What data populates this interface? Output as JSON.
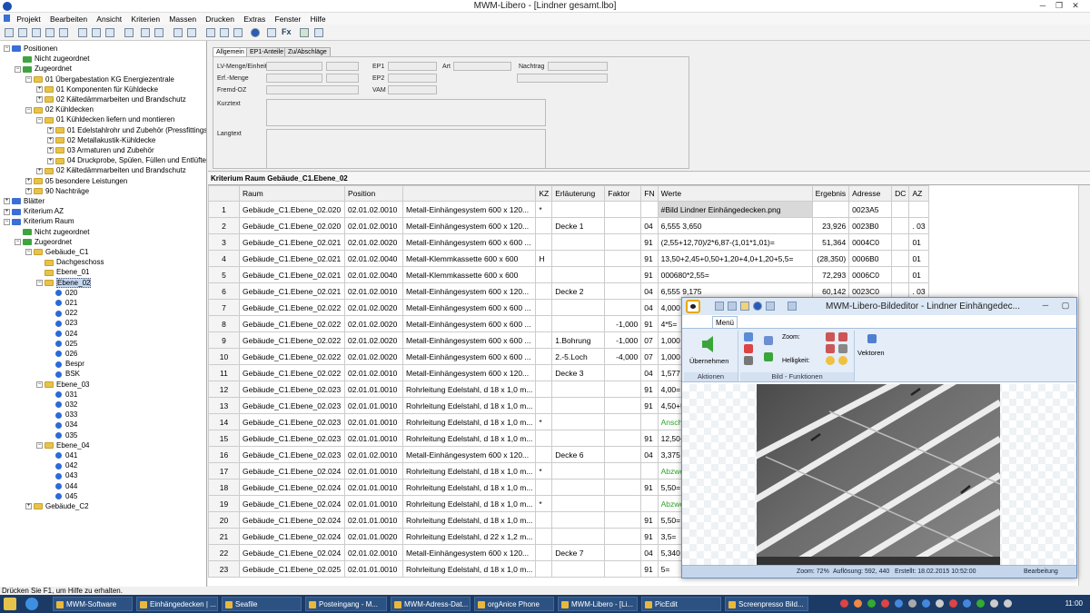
{
  "window": {
    "title": "MWM-Libero - [Lindner gesamt.lbo]"
  },
  "menu": [
    "Projekt",
    "Bearbeiten",
    "Ansicht",
    "Kriterien",
    "Massen",
    "Drucken",
    "Extras",
    "Fenster",
    "Hilfe"
  ],
  "toolbar": {
    "fx_label": "Fx"
  },
  "tree": [
    {
      "label": "Positionen",
      "level": 0,
      "icon": "blue",
      "exp": "−"
    },
    {
      "label": "Nicht zugeordnet",
      "level": 1,
      "icon": "green"
    },
    {
      "label": "Zugeordnet",
      "level": 1,
      "icon": "green",
      "exp": "−"
    },
    {
      "label": "01 Übergabestation KG Energiezentrale",
      "level": 2,
      "icon": "yellow",
      "exp": "−"
    },
    {
      "label": "01 Komponenten für Kühldecke",
      "level": 3,
      "icon": "yellow",
      "exp": "+"
    },
    {
      "label": "02 Kältedämmarbeiten und Brandschutz",
      "level": 3,
      "icon": "yellow",
      "exp": "+"
    },
    {
      "label": "02 Kühldecken",
      "level": 2,
      "icon": "yellow",
      "exp": "−"
    },
    {
      "label": "01 Kühldecken liefern und montieren",
      "level": 3,
      "icon": "yellow",
      "exp": "−"
    },
    {
      "label": "01 Edelstahlrohr und Zubehör (Pressfittings)",
      "level": 4,
      "icon": "yellow",
      "exp": "+"
    },
    {
      "label": "02 Metallakustik-Kühldecke",
      "level": 4,
      "icon": "yellow",
      "exp": "+"
    },
    {
      "label": "03 Armaturen und Zubehör",
      "level": 4,
      "icon": "yellow",
      "exp": "+"
    },
    {
      "label": "04 Druckprobe, Spülen, Füllen und Entlüften",
      "level": 4,
      "icon": "yellow",
      "exp": "+"
    },
    {
      "label": "02 Kältedämmarbeiten und Brandschutz",
      "level": 3,
      "icon": "yellow",
      "exp": "+"
    },
    {
      "label": "05 besondere Leistungen",
      "level": 2,
      "icon": "yellow",
      "exp": "+"
    },
    {
      "label": "90 Nachträge",
      "level": 2,
      "icon": "yellow",
      "exp": "+"
    },
    {
      "label": "Blätter",
      "level": 0,
      "icon": "blue",
      "exp": "+"
    },
    {
      "label": "Kriterium AZ",
      "level": 0,
      "icon": "blue",
      "exp": "+"
    },
    {
      "label": "Kriterium Raum",
      "level": 0,
      "icon": "blue",
      "exp": "−"
    },
    {
      "label": "Nicht zugeordnet",
      "level": 1,
      "icon": "green"
    },
    {
      "label": "Zugeordnet",
      "level": 1,
      "icon": "green",
      "exp": "−"
    },
    {
      "label": "Gebäude_C1",
      "level": 2,
      "icon": "yellow",
      "exp": "−"
    },
    {
      "label": "Dachgeschoss",
      "level": 3,
      "icon": "yellow"
    },
    {
      "label": "Ebene_01",
      "level": 3,
      "icon": "yellow"
    },
    {
      "label": "Ebene_02",
      "level": 3,
      "icon": "yellow",
      "exp": "−",
      "selected": true
    },
    {
      "label": "020",
      "level": 4,
      "icon": "dot"
    },
    {
      "label": "021",
      "level": 4,
      "icon": "dot"
    },
    {
      "label": "022",
      "level": 4,
      "icon": "dot"
    },
    {
      "label": "023",
      "level": 4,
      "icon": "dot"
    },
    {
      "label": "024",
      "level": 4,
      "icon": "dot"
    },
    {
      "label": "025",
      "level": 4,
      "icon": "dot"
    },
    {
      "label": "026",
      "level": 4,
      "icon": "dot"
    },
    {
      "label": "Bespr",
      "level": 4,
      "icon": "dot"
    },
    {
      "label": "BSK",
      "level": 4,
      "icon": "dot"
    },
    {
      "label": "Ebene_03",
      "level": 3,
      "icon": "yellow",
      "exp": "−"
    },
    {
      "label": "031",
      "level": 4,
      "icon": "dot"
    },
    {
      "label": "032",
      "level": 4,
      "icon": "dot"
    },
    {
      "label": "033",
      "level": 4,
      "icon": "dot"
    },
    {
      "label": "034",
      "level": 4,
      "icon": "dot"
    },
    {
      "label": "035",
      "level": 4,
      "icon": "dot"
    },
    {
      "label": "Ebene_04",
      "level": 3,
      "icon": "yellow",
      "exp": "−"
    },
    {
      "label": "041",
      "level": 4,
      "icon": "dot"
    },
    {
      "label": "042",
      "level": 4,
      "icon": "dot"
    },
    {
      "label": "043",
      "level": 4,
      "icon": "dot"
    },
    {
      "label": "044",
      "level": 4,
      "icon": "dot"
    },
    {
      "label": "045",
      "level": 4,
      "icon": "dot"
    },
    {
      "label": "Gebäude_C2",
      "level": 2,
      "icon": "yellow",
      "exp": "+"
    }
  ],
  "form": {
    "tabs": [
      "Allgemein",
      "EP1-Anteile",
      "Zu/Abschläge"
    ],
    "labels": {
      "lv": "LV-Menge/Einheit",
      "erf": "Erf.-Menge",
      "fremd": "Fremd-OZ",
      "ep1": "EP1",
      "ep2": "EP2",
      "vam": "VAM",
      "art": "Art",
      "nachtrag": "Nachtrag",
      "kurztext": "Kurztext",
      "langtext": "Langtext"
    }
  },
  "grid": {
    "header": "Kriterium Raum Gebäude_C1.Ebene_02",
    "columns": [
      "",
      "Raum",
      "Position",
      "",
      "KZ",
      "Erläuterung",
      "Faktor",
      "FN",
      "Werte",
      "Ergebnis",
      "Adresse",
      "DC",
      "AZ"
    ],
    "rows": [
      [
        "1",
        "Gebäude_C1.Ebene_02.020",
        "02.01.02.0010",
        "Metall-Einhängesystem 600 x 120...",
        "*",
        "",
        "",
        "",
        "#Bild Lindner Einhängedecken.png",
        "",
        "0023A5",
        "",
        ""
      ],
      [
        "2",
        "Gebäude_C1.Ebene_02.020",
        "02.01.02.0010",
        "Metall-Einhängesystem 600 x 120...",
        "",
        "Decke 1",
        "",
        "04",
        "6,555 3,650",
        "23,926",
        "0023B0",
        "",
        ". 03"
      ],
      [
        "3",
        "Gebäude_C1.Ebene_02.021",
        "02.01.02.0020",
        "Metall-Einhängesystem 600 x 600 ...",
        "",
        "",
        "",
        "91",
        "(2,55+12,70)/2*6,87-(1,01*1,01)=",
        "51,364",
        "0004C0",
        "",
        "01"
      ],
      [
        "4",
        "Gebäude_C1.Ebene_02.021",
        "02.01.02.0040",
        "Metall-Klemmkassette 600 x 600",
        "H",
        "",
        "",
        "91",
        "13,50+2,45+0,50+1,20+4,0+1,20+5,5=",
        "(28,350)",
        "0006B0",
        "",
        "01"
      ],
      [
        "5",
        "Gebäude_C1.Ebene_02.021",
        "02.01.02.0040",
        "Metall-Klemmkassette 600 x 600",
        "",
        "",
        "",
        "91",
        "000680*2,55=",
        "72,293",
        "0006C0",
        "",
        "01"
      ],
      [
        "6",
        "Gebäude_C1.Ebene_02.021",
        "02.01.02.0010",
        "Metall-Einhängesystem 600 x 120...",
        "",
        "Decke 2",
        "",
        "04",
        "6,555 9,175",
        "60,142",
        "0023C0",
        "",
        ". 03"
      ],
      [
        "7",
        "Gebäude_C1.Ebene_02.022",
        "02.01.02.0020",
        "Metall-Einhängesystem 600 x 600 ...",
        "",
        "",
        "",
        "04",
        "4,000 5,00",
        "",
        "",
        "",
        ""
      ],
      [
        "8",
        "Gebäude_C1.Ebene_02.022",
        "02.01.02.0020",
        "Metall-Einhängesystem 600 x 600 ...",
        "",
        "",
        "-1,000",
        "91",
        "4*5=",
        "",
        "",
        "",
        ""
      ],
      [
        "9",
        "Gebäude_C1.Ebene_02.022",
        "02.01.02.0020",
        "Metall-Einhängesystem 600 x 600 ...",
        "",
        "1.Bohrung",
        "-1,000",
        "07",
        "1,000 400",
        "",
        "",
        "",
        ""
      ],
      [
        "10",
        "Gebäude_C1.Ebene_02.022",
        "02.01.02.0020",
        "Metall-Einhängesystem 600 x 600 ...",
        "",
        "2.-5.Loch",
        "-4,000",
        "07",
        "1,000 400",
        "",
        "",
        "",
        ""
      ],
      [
        "11",
        "Gebäude_C1.Ebene_02.022",
        "02.01.02.0010",
        "Metall-Einhängesystem 600 x 120...",
        "",
        "Decke 3",
        "",
        "04",
        "1,577 4,24",
        "",
        "",
        "",
        ""
      ],
      [
        "12",
        "Gebäude_C1.Ebene_02.023",
        "02.01.01.0010",
        "Rohrleitung Edelstahl, d 18 x 1,0 m...",
        "",
        "",
        "",
        "91",
        "4,00=",
        "",
        "",
        "",
        ""
      ],
      [
        "13",
        "Gebäude_C1.Ebene_02.023",
        "02.01.01.0010",
        "Rohrleitung Edelstahl, d 18 x 1,0 m...",
        "",
        "",
        "",
        "91",
        "4,50+5,60",
        "",
        "",
        "",
        ""
      ],
      [
        "14",
        "Gebäude_C1.Ebene_02.023",
        "02.01.01.0010",
        "Rohrleitung Edelstahl, d 18 x 1,0 m...",
        "*",
        "",
        "",
        "",
        "Anschluss",
        "",
        "",
        "",
        ""
      ],
      [
        "15",
        "Gebäude_C1.Ebene_02.023",
        "02.01.01.0010",
        "Rohrleitung Edelstahl, d 18 x 1,0 m...",
        "",
        "",
        "",
        "91",
        "12,50+3,3",
        "",
        "",
        "",
        ""
      ],
      [
        "16",
        "Gebäude_C1.Ebene_02.023",
        "02.01.02.0010",
        "Metall-Einhängesystem 600 x 120...",
        "",
        "Decke 6",
        "",
        "04",
        "3,375 5,08",
        "",
        "",
        "",
        ""
      ],
      [
        "17",
        "Gebäude_C1.Ebene_02.024",
        "02.01.01.0010",
        "Rohrleitung Edelstahl, d 18 x 1,0 m...",
        "*",
        "",
        "",
        "",
        "Abzweig 1",
        "",
        "",
        "",
        ""
      ],
      [
        "18",
        "Gebäude_C1.Ebene_02.024",
        "02.01.01.0010",
        "Rohrleitung Edelstahl, d 18 x 1,0 m...",
        "",
        "",
        "",
        "91",
        "5,50=",
        "",
        "",
        "",
        ""
      ],
      [
        "19",
        "Gebäude_C1.Ebene_02.024",
        "02.01.01.0010",
        "Rohrleitung Edelstahl, d 18 x 1,0 m...",
        "*",
        "",
        "",
        "",
        "Abzweig 2",
        "",
        "",
        "",
        ""
      ],
      [
        "20",
        "Gebäude_C1.Ebene_02.024",
        "02.01.01.0010",
        "Rohrleitung Edelstahl, d 18 x 1,0 m...",
        "",
        "",
        "",
        "91",
        "5,50=",
        "",
        "",
        "",
        ""
      ],
      [
        "21",
        "Gebäude_C1.Ebene_02.024",
        "02.01.01.0020",
        "Rohrleitung Edelstahl, d 22 x 1,2 m...",
        "",
        "",
        "",
        "91",
        "3,5=",
        "",
        "",
        "",
        ""
      ],
      [
        "22",
        "Gebäude_C1.Ebene_02.024",
        "02.01.02.0010",
        "Metall-Einhängesystem 600 x 120...",
        "",
        "Decke 7",
        "",
        "04",
        "5,340 2,50",
        "",
        "",
        "",
        ""
      ],
      [
        "23",
        "Gebäude_C1.Ebene_02.025",
        "02.01.01.0010",
        "Rohrleitung Edelstahl, d 18 x 1,0 m...",
        "",
        "",
        "",
        "91",
        "5=",
        "",
        "",
        "",
        ""
      ]
    ],
    "green_rows": [
      14,
      17,
      19
    ],
    "graybg_rows": [
      1
    ]
  },
  "editor": {
    "title": "MWM-Libero-Bildeditor - Lindner Einhängedec...",
    "tab": "Menü",
    "groups": {
      "aktionen": "Aktionen",
      "bild": "Bild - Funktionen"
    },
    "uebernehmen": "Übernehmen",
    "zoom_label": "Zoom:",
    "helligkeit_label": "Helligkeit:",
    "vektoren": "Vektoren",
    "status": {
      "zoom": "Zoom: 72%",
      "aufloesung": "Auflösung: 592, 440",
      "erstellt": "Erstellt: 18.02.2015 10:52:00",
      "mode": "Bearbeitung"
    }
  },
  "statusbar": "Drücken Sie F1, um Hilfe zu erhalten.",
  "taskbar": {
    "items": [
      "MWM-Software",
      "Einhängedecken | ...",
      "Seafile",
      "Posteingang - M...",
      "MWM-Adress-Dat...",
      "orgAnice Phone",
      "MWM-Libero - [Li...",
      "PicEdit",
      "Screenpresso Bild..."
    ],
    "clock": "11:00"
  }
}
